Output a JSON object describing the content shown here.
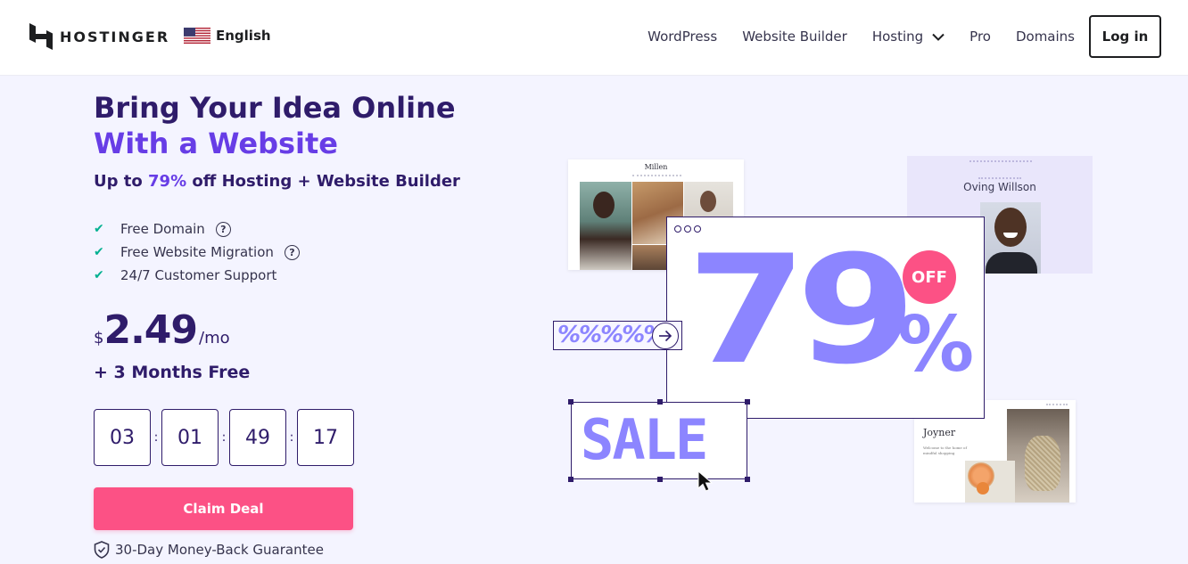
{
  "header": {
    "brand": "HOSTINGER",
    "language": "English",
    "nav": [
      {
        "label": "WordPress"
      },
      {
        "label": "Website Builder"
      },
      {
        "label": "Hosting",
        "has_dropdown": true
      },
      {
        "label": "Pro"
      },
      {
        "label": "Domains"
      }
    ],
    "login_label": "Log in"
  },
  "hero": {
    "title_line1": "Bring Your Idea Online",
    "title_line2": "With a Website",
    "subtitle_prefix": "Up to ",
    "subtitle_pct": "79%",
    "subtitle_suffix": " off Hosting + Website Builder",
    "features": [
      {
        "label": "Free Domain",
        "has_help": true
      },
      {
        "label": "Free Website Migration",
        "has_help": true
      },
      {
        "label": "24/7 Customer Support",
        "has_help": false
      }
    ],
    "price": {
      "currency": "$",
      "amount": "2.49",
      "period": "/mo"
    },
    "bonus": "+ 3 Months Free",
    "countdown": [
      "03",
      "01",
      "49",
      "17"
    ],
    "countdown_separator": ":",
    "cta_label": "Claim Deal",
    "guarantee": "30-Day Money-Back Guarantee"
  },
  "illustration": {
    "discount_big": "79",
    "discount_pct_sign": "%",
    "off_badge": "OFF",
    "percent_strip": "%%%%%",
    "sale_text": "SALE",
    "template_1_title": "Millen",
    "template_2_title": "Oving Willson",
    "template_3_title": "Joyner",
    "template_3_body": "Welcome to the home of mindful shopping"
  },
  "colors": {
    "brand_purple": "#673de6",
    "dark_purple": "#2f1c6a",
    "pink": "#fc5185",
    "check_green": "#00b090",
    "illustration_violet": "#8c85ff"
  }
}
